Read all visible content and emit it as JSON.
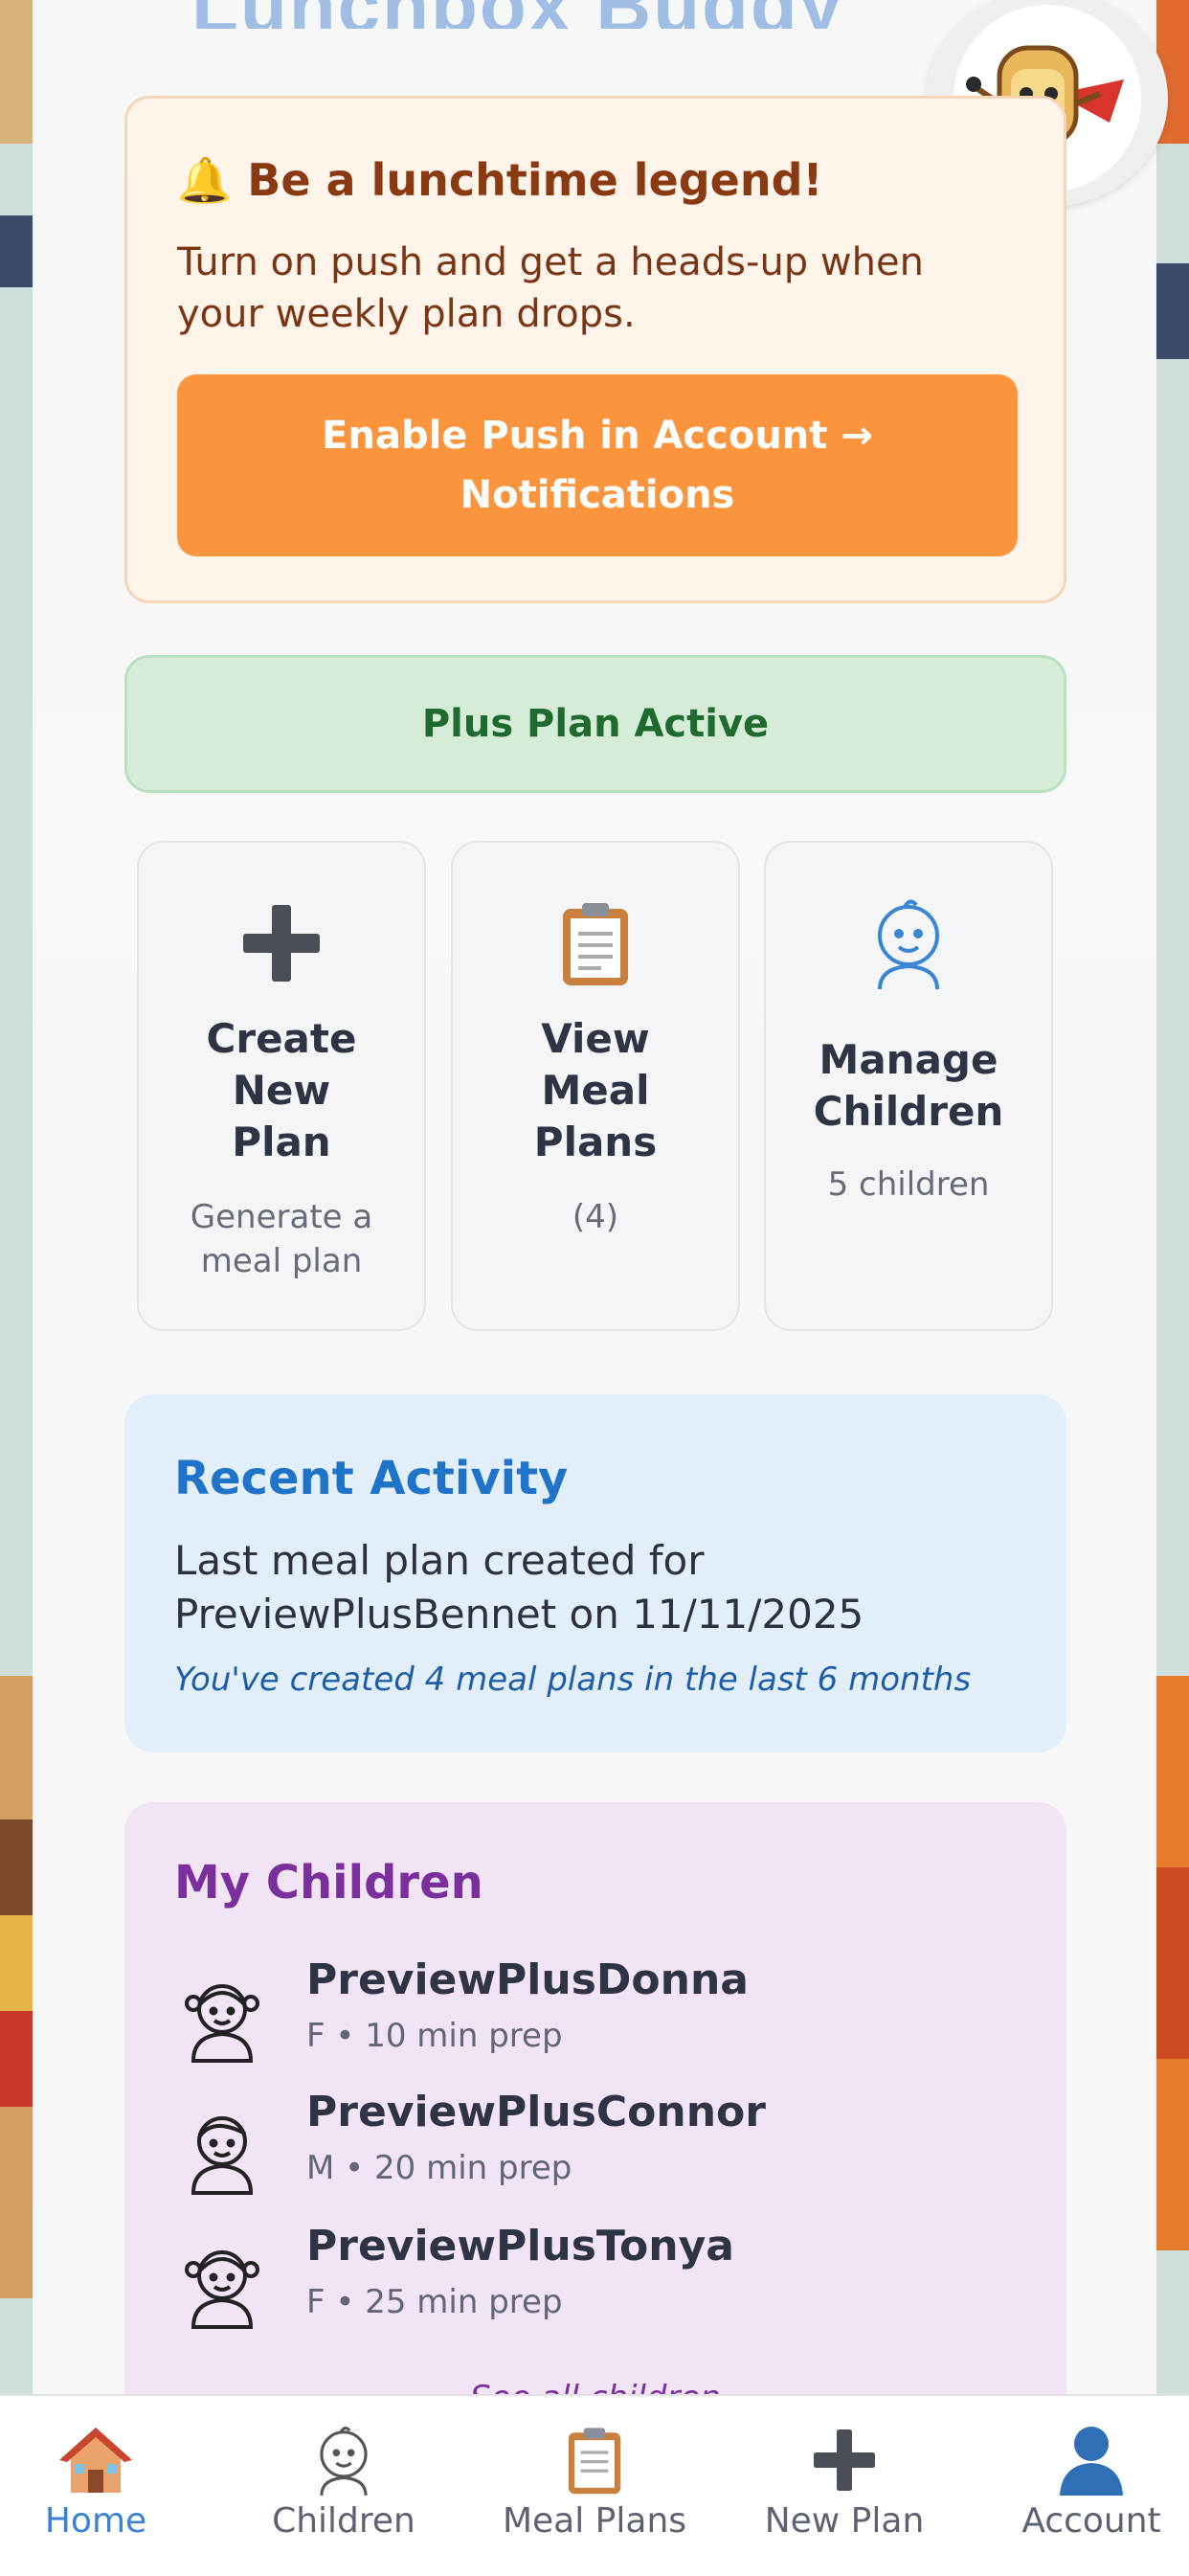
{
  "header": {
    "title": "Lunchbox Buddy"
  },
  "push_prompt": {
    "title": "Be a lunchtime legend!",
    "bell_icon": "bell-icon",
    "text": "Turn on push and get a heads-up when your weekly plan drops.",
    "button_label": "Enable Push in Account → Notifications"
  },
  "plan_status": {
    "label": "Plus Plan Active"
  },
  "quick_actions": [
    {
      "icon": "plus-icon",
      "label": "Create New Plan",
      "sub": "Generate a meal plan"
    },
    {
      "icon": "clipboard-icon",
      "label": "View Meal Plans",
      "sub": "(4)"
    },
    {
      "icon": "baby-face-icon",
      "label": "Manage Children",
      "sub": "5 children"
    }
  ],
  "recent_activity": {
    "title": "Recent Activity",
    "text": "Last meal plan created for PreviewPlusBennet on 11/11/2025",
    "note": "You've created 4 meal plans in the last 6 months"
  },
  "children": {
    "title": "My Children",
    "items": [
      {
        "name": "PreviewPlusDonna",
        "meta": "F • 10 min prep",
        "icon": "girl-icon"
      },
      {
        "name": "PreviewPlusConnor",
        "meta": "M • 20 min prep",
        "icon": "boy-icon"
      },
      {
        "name": "PreviewPlusTonya",
        "meta": "F • 25 min prep",
        "icon": "girl-icon"
      }
    ],
    "see_all": "See all children"
  },
  "tabbar": [
    {
      "label": "Home",
      "icon": "home-icon",
      "active": true
    },
    {
      "label": "Children",
      "icon": "baby-face-icon"
    },
    {
      "label": "Meal Plans",
      "icon": "clipboard-icon"
    },
    {
      "label": "New Plan",
      "icon": "plus-icon"
    },
    {
      "label": "Account",
      "icon": "person-icon"
    }
  ],
  "colors": {
    "accent_orange": "#fb953d",
    "active_tab": "#3b82d6",
    "plan_green": "#1f6a2f",
    "recent_blue": "#1f73c8",
    "children_purple": "#7a2f9c"
  }
}
